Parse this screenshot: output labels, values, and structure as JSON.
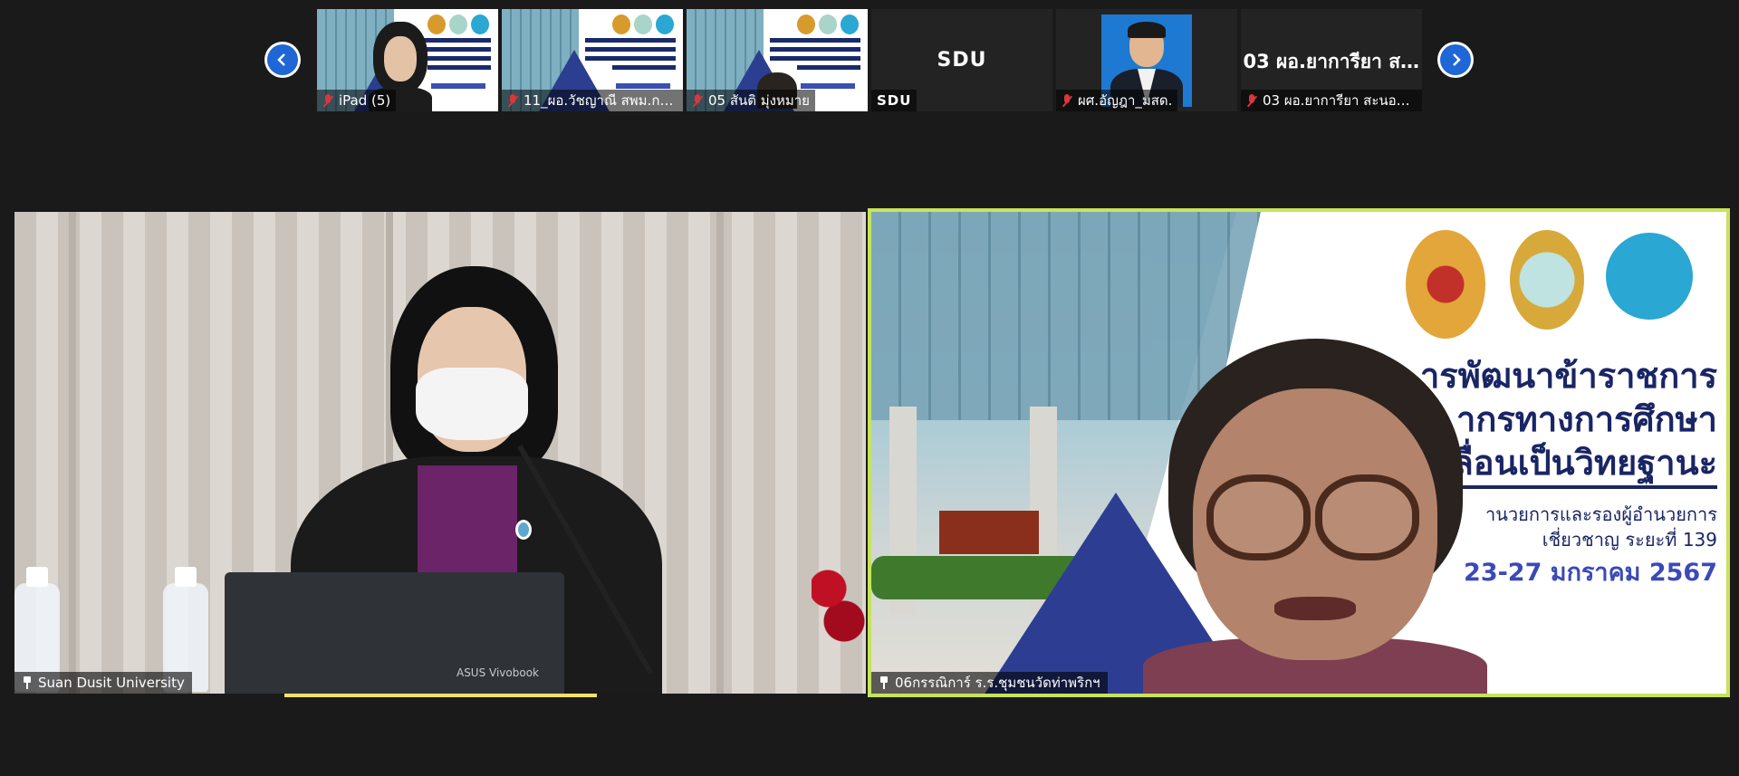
{
  "app": {
    "name": "Zoom meeting"
  },
  "carousel": {
    "prev_icon": "chevron-left-icon",
    "next_icon": "chevron-right-icon"
  },
  "participants_strip": [
    {
      "id": "p1",
      "label": "iPad (5)",
      "muted": true,
      "type": "video-slide"
    },
    {
      "id": "p2",
      "label": "11_ผอ.วัชญาณี สพม.กา...",
      "muted": true,
      "type": "video-slide"
    },
    {
      "id": "p3",
      "label": "05 สันติ มุ่งหมาย",
      "muted": true,
      "type": "video-slide"
    },
    {
      "id": "p4",
      "label": "SDU",
      "center_text": "SDU",
      "muted": false,
      "type": "name-only"
    },
    {
      "id": "p5",
      "label": "ผศ.อัญฎา_มสด.",
      "muted": true,
      "type": "photo"
    },
    {
      "id": "p6",
      "label": "03 ผอ.ยาการียา สะนอพิท...",
      "center_text": "03 ผอ.ยาการียา ส...",
      "muted": true,
      "type": "name-only"
    }
  ],
  "main_tiles": {
    "left": {
      "label": "Suan Dusit University",
      "laptop_brand": "ASUS Vivobook"
    },
    "right": {
      "label": "06กรรณิการ์ ร.ร.ชุมชนวัดท่าพริกฯ",
      "slide": {
        "line1": "ารพัฒนาข้าราชการ",
        "line2": "ากรทางการศึกษา",
        "line3": "ก",
        "line3b": "ลื่อนเป็นวิทยฐานะ",
        "line4": "านวยการและรองผู้อำนวยการ",
        "line5": "เชี่ยวชาญ ระยะที่ 139",
        "date": "23-27 มกราคม 2567"
      }
    }
  },
  "colors": {
    "background": "#1a1a1a",
    "active_speaker_border": "#c8e35a",
    "nav_button": "#1f66d6",
    "muted_icon": "#d9363e",
    "slide_title": "#1a2565",
    "slide_date": "#3b49b8"
  }
}
